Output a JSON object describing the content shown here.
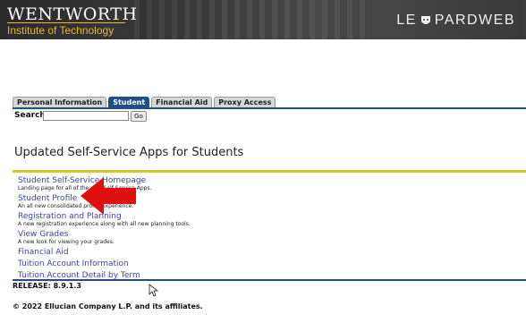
{
  "header": {
    "logo_line1": "WENTWORTH",
    "logo_line2": "Institute of Technology",
    "brand_left": "LE",
    "brand_right": "PARDWEB",
    "brand_icon": "leopard-paw-icon",
    "colors": {
      "banner": "#3a3a3a",
      "logo_gold": "#e8b830"
    }
  },
  "tabs": [
    {
      "label": "Personal Information",
      "active": false
    },
    {
      "label": "Student",
      "active": true
    },
    {
      "label": "Financial Aid",
      "active": false
    },
    {
      "label": "Proxy Access",
      "active": false
    }
  ],
  "search": {
    "label": "Search",
    "value": "",
    "go_label": "Go"
  },
  "main": {
    "heading": "Updated Self-Service Apps for Students",
    "links": [
      {
        "label": "Student Self-Service Homepage",
        "desc": "Landing page for all of the new Self-Service Apps."
      },
      {
        "label": "Student Profile",
        "desc": "An all new consolidated profile experience."
      },
      {
        "label": "Registration and Planning",
        "desc": "A new registration experience along with all new planning tools."
      },
      {
        "label": "View Grades",
        "desc": "A new look for viewing your grades."
      },
      {
        "label": "Financial Aid",
        "desc": ""
      },
      {
        "label": "Tuition Account Information",
        "desc": ""
      },
      {
        "label": "Tuition Account Detail by Term",
        "desc": ""
      }
    ]
  },
  "footer": {
    "release": "RELEASE: 8.9.1.3",
    "copyright": "© 2022 Ellucian Company L.P. and its affiliates."
  },
  "colors": {
    "tab_active": "#1f4f85",
    "accent_rule": "#d4cc2a",
    "link": "#3b46a6",
    "arrow": "#e01010"
  }
}
